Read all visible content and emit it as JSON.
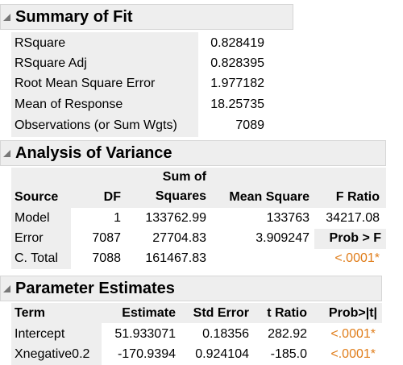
{
  "summary_of_fit": {
    "title": "Summary of Fit",
    "rows": [
      {
        "label": "RSquare",
        "value": "0.828419"
      },
      {
        "label": "RSquare Adj",
        "value": "0.828395"
      },
      {
        "label": "Root Mean Square Error",
        "value": "1.977182"
      },
      {
        "label": "Mean of Response",
        "value": "18.25735"
      },
      {
        "label": "Observations (or Sum Wgts)",
        "value": "7089"
      }
    ]
  },
  "anova": {
    "title": "Analysis of Variance",
    "headers": {
      "source": "Source",
      "df": "DF",
      "ss_top": "Sum of",
      "ss_bottom": "Squares",
      "ms": "Mean Square",
      "f": "F Ratio"
    },
    "rows": [
      {
        "source": "Model",
        "df": "1",
        "ss": "133762.99",
        "ms": "133763",
        "f": "34217.08"
      },
      {
        "source": "Error",
        "df": "7087",
        "ss": "27704.83",
        "ms": "3.909247",
        "f": "Prob > F"
      },
      {
        "source": "C. Total",
        "df": "7088",
        "ss": "161467.83",
        "ms": "",
        "f": "<.0001*"
      }
    ]
  },
  "parameter_estimates": {
    "title": "Parameter Estimates",
    "headers": {
      "term": "Term",
      "estimate": "Estimate",
      "std_error": "Std Error",
      "t_ratio": "t Ratio",
      "prob": "Prob>|t|"
    },
    "rows": [
      {
        "term": "Intercept",
        "estimate": "51.933071",
        "std_error": "0.18356",
        "t_ratio": "282.92",
        "prob": "<.0001*"
      },
      {
        "term": "Xnegative0.2",
        "estimate": "-170.9394",
        "std_error": "0.924104",
        "t_ratio": "-185.0",
        "prob": "<.0001*"
      }
    ]
  },
  "colors": {
    "significant": "#e07d1a",
    "header_bg": "#eeeeee"
  }
}
